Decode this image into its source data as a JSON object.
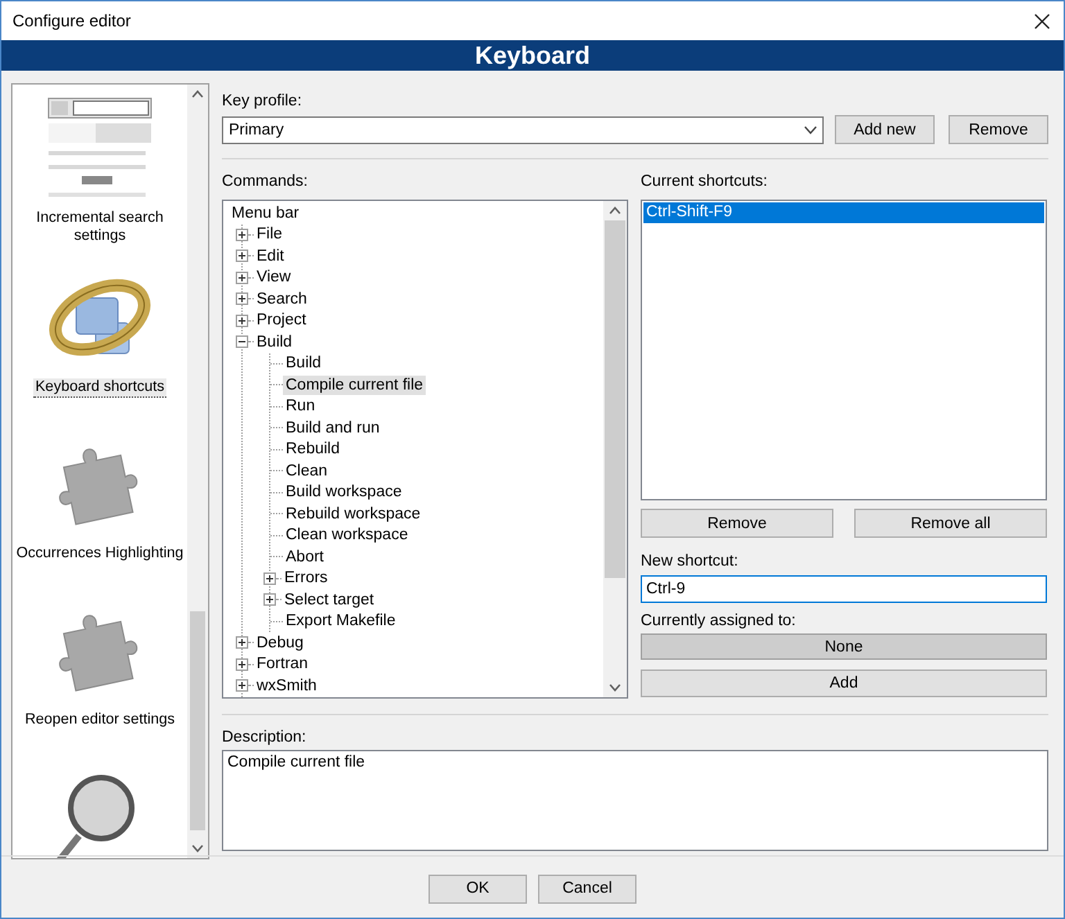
{
  "window": {
    "title": "Configure editor"
  },
  "banner": {
    "title": "Keyboard"
  },
  "sidebar": {
    "items": [
      {
        "kind": "search-thumbnail",
        "label": "Incremental search settings",
        "selected": false
      },
      {
        "kind": "keyboard-ring",
        "label": "Keyboard shortcuts",
        "selected": true
      },
      {
        "kind": "puzzle",
        "label": "Occurrences Highlighting",
        "selected": false
      },
      {
        "kind": "puzzle",
        "label": "Reopen editor settings",
        "selected": false
      },
      {
        "kind": "magnifier",
        "selected": false
      }
    ]
  },
  "key_profile": {
    "label": "Key profile:",
    "value": "Primary",
    "buttons": [
      "Add new",
      "Remove"
    ]
  },
  "commands": {
    "label": "Commands:",
    "tree": [
      {
        "label": "Menu bar",
        "selected": false,
        "children": [
          {
            "label": "File",
            "expanded": false,
            "selected": false
          },
          {
            "label": "Edit",
            "expanded": false,
            "selected": false
          },
          {
            "label": "View",
            "expanded": false,
            "selected": false
          },
          {
            "label": "Search",
            "expanded": false,
            "selected": false
          },
          {
            "label": "Project",
            "expanded": false,
            "selected": false
          },
          {
            "label": "Build",
            "expanded": true,
            "selected": false,
            "children": [
              {
                "label": "Build",
                "selected": false
              },
              {
                "label": "Compile current file",
                "selected": true
              },
              {
                "label": "Run",
                "selected": false
              },
              {
                "label": "Build and run",
                "selected": false
              },
              {
                "label": "Rebuild",
                "selected": false
              },
              {
                "label": "Clean",
                "selected": false
              },
              {
                "label": "Build workspace",
                "selected": false
              },
              {
                "label": "Rebuild workspace",
                "selected": false
              },
              {
                "label": "Clean workspace",
                "selected": false
              },
              {
                "label": "Abort",
                "selected": false
              },
              {
                "label": "Errors",
                "expanded": false,
                "selected": false
              },
              {
                "label": "Select target",
                "expanded": false,
                "selected": false
              },
              {
                "label": "Export Makefile",
                "selected": false
              }
            ]
          },
          {
            "label": "Debug",
            "expanded": false,
            "selected": false
          },
          {
            "label": "Fortran",
            "expanded": false,
            "selected": false
          },
          {
            "label": "wxSmith",
            "expanded": false,
            "selected": false
          }
        ]
      }
    ]
  },
  "current_shortcuts": {
    "label": "Current shortcuts:",
    "items": [
      {
        "text": "Ctrl-Shift-F9",
        "selected": true
      }
    ],
    "buttons": [
      "Remove",
      "Remove all"
    ]
  },
  "new_shortcut": {
    "label": "New shortcut:",
    "value": "Ctrl-9"
  },
  "assigned": {
    "label": "Currently assigned to:",
    "value": "None"
  },
  "add_button": "Add",
  "description": {
    "label": "Description:",
    "value": "Compile current file"
  },
  "buttons": [
    "OK",
    "Cancel"
  ]
}
